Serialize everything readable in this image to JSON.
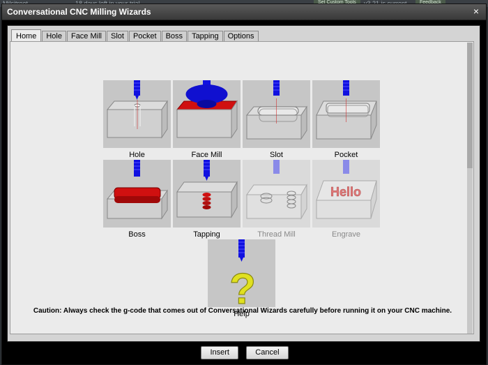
{
  "window": {
    "title": "Conversational CNC Milling Wizards",
    "close_glyph": "×"
  },
  "background": {
    "left_text": "Milsitreet",
    "center_text": "18 days left in your trial",
    "right_btn1": "Set Custom Tools",
    "right_text": "v3.21 is current",
    "right_btn2": "Feedback"
  },
  "tabs": [
    {
      "label": "Home"
    },
    {
      "label": "Hole"
    },
    {
      "label": "Face Mill"
    },
    {
      "label": "Slot"
    },
    {
      "label": "Pocket"
    },
    {
      "label": "Boss"
    },
    {
      "label": "Tapping"
    },
    {
      "label": "Options"
    }
  ],
  "wizards": [
    {
      "label": "Hole",
      "icon": "hole-icon"
    },
    {
      "label": "Face Mill",
      "icon": "face-mill-icon"
    },
    {
      "label": "Slot",
      "icon": "slot-icon"
    },
    {
      "label": "Pocket",
      "icon": "pocket-icon"
    },
    {
      "label": "Boss",
      "icon": "boss-icon"
    },
    {
      "label": "Tapping",
      "icon": "tapping-icon"
    },
    {
      "label": "Thread Mill",
      "icon": "thread-mill-icon",
      "disabled": true
    },
    {
      "label": "Engrave",
      "icon": "engrave-icon",
      "disabled": true,
      "engrave_text": "Hello"
    },
    {
      "label": "Help",
      "icon": "help-icon",
      "glyph": "?"
    }
  ],
  "caution": "Caution: Always check the g-code that comes out of Conversational Wizards carefully before running it on your CNC machine.",
  "buttons": {
    "insert": "Insert",
    "cancel": "Cancel"
  },
  "colors": {
    "tool": "#1010e0",
    "cut": "#d01010",
    "help": "#e0e020"
  }
}
